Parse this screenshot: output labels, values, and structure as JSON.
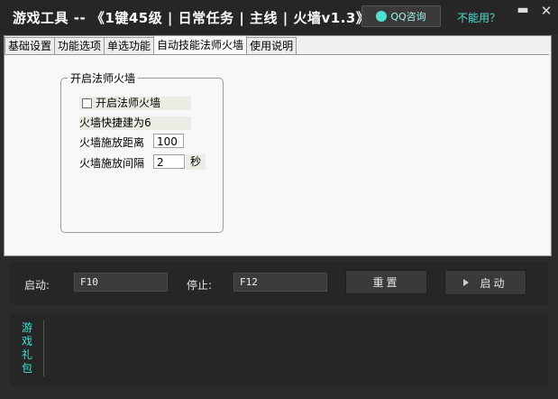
{
  "window": {
    "title": "游戏工具 -- 《1键45级 | 日常任务 | 主线 | 火墙v1.3》",
    "qq_button": "QQ咨询",
    "help_link": "不能用？",
    "minimize": "▬",
    "close": "✕"
  },
  "tabs": [
    {
      "label": "基础设置"
    },
    {
      "label": "功能选项"
    },
    {
      "label": "单选功能"
    },
    {
      "label": "自动技能法师火墙"
    },
    {
      "label": "使用说明"
    }
  ],
  "active_tab_index": 3,
  "fire_wall": {
    "group_title": "开启法师火墙",
    "checkbox_label": "开启法师火墙",
    "checked": false,
    "hotkey_text": "火墙快捷建为6",
    "distance_label": "火墙施放距离",
    "distance_value": "100",
    "interval_label": "火墙施放间隔",
    "interval_value": "2",
    "interval_unit": "秒"
  },
  "controls": {
    "start_label": "启动:",
    "start_key": "F10",
    "stop_label": "停止:",
    "stop_key": "F12",
    "reset_button": "重置",
    "start_button": "启动"
  },
  "gift": {
    "label": "游戏礼包"
  },
  "colors": {
    "background": "#2b2b2b",
    "accent": "#4fe0d0",
    "panel": "#f0f0f0"
  }
}
